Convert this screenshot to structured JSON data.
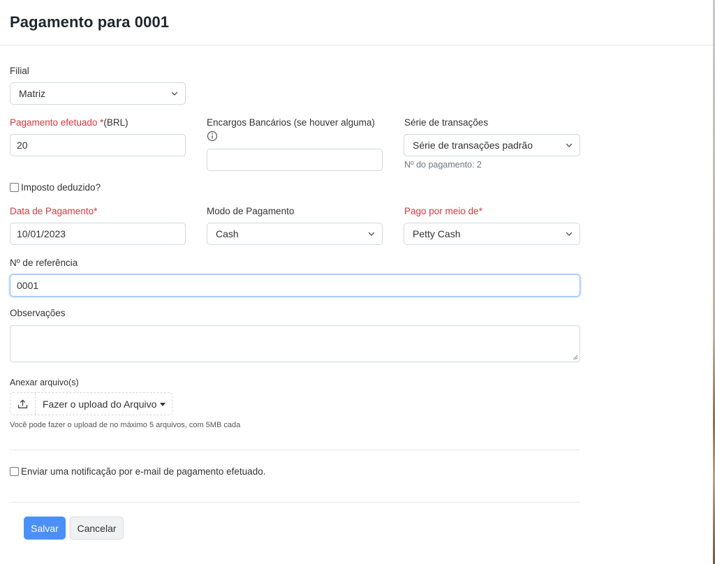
{
  "header": {
    "title": "Pagamento para 0001"
  },
  "form": {
    "branch": {
      "label": "Filial",
      "value": "Matriz"
    },
    "payment_made": {
      "label_req": "Pagamento efetuado *",
      "label_suffix": "(BRL)",
      "value": "20"
    },
    "bank_charges": {
      "label": "Encargos Bancários (se houver alguma)",
      "value": ""
    },
    "transaction_series": {
      "label": "Série de transações",
      "value": "Série de transações padrão",
      "hint": "Nº do pagamento:  2"
    },
    "tax_deducted": {
      "label": "Imposto deduzido?",
      "checked": false
    },
    "payment_date": {
      "label": "Data de Pagamento*",
      "value": "10/01/2023"
    },
    "payment_mode": {
      "label": "Modo de Pagamento",
      "value": "Cash"
    },
    "paid_through": {
      "label": "Pago por meio de*",
      "value": "Petty Cash"
    },
    "reference": {
      "label": "Nº de referência",
      "value": "0001"
    },
    "notes": {
      "label": "Observações",
      "value": ""
    },
    "attachments": {
      "label": "Anexar arquivo(s)",
      "upload_label": "Fazer o upload do Arquivo",
      "hint": "Você pode fazer o upload de no máximo 5 arquivos, com 5MB cada"
    },
    "email_notification": {
      "label": "Enviar uma notificação por e-mail de pagamento efetuado.",
      "checked": false
    }
  },
  "actions": {
    "save": "Salvar",
    "cancel": "Cancelar"
  },
  "colors": {
    "primary": "#4a90f7",
    "required": "#d9363e",
    "border": "#d1d8dd"
  },
  "icons": [
    "chevron-down-icon",
    "info-icon",
    "upload-icon",
    "caret-down-icon"
  ]
}
